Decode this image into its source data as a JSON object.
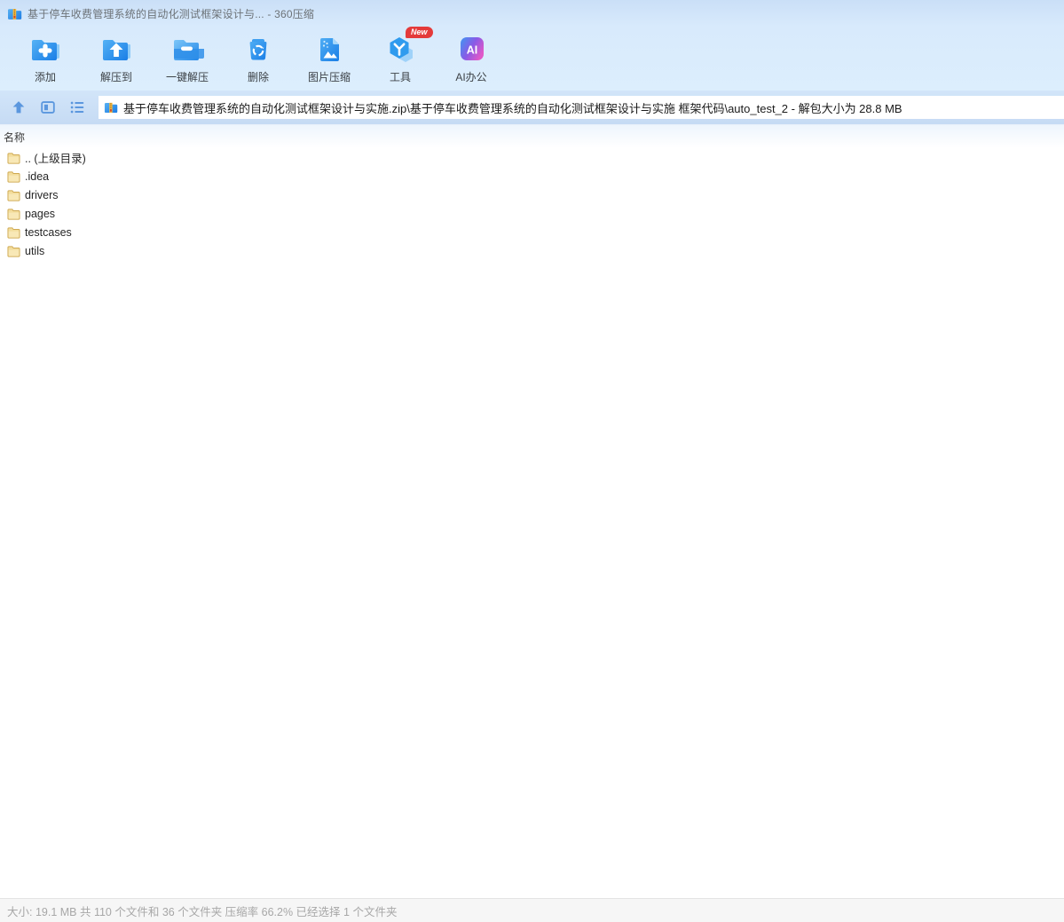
{
  "window": {
    "title": "基于停车收费管理系统的自动化测试框架设计与... - 360压缩"
  },
  "toolbar": {
    "buttons": [
      {
        "label": "添加",
        "icon": "add-archive-icon"
      },
      {
        "label": "解压到",
        "icon": "extract-to-icon"
      },
      {
        "label": "一键解压",
        "icon": "one-click-extract-icon"
      },
      {
        "label": "删除",
        "icon": "delete-icon"
      },
      {
        "label": "图片压缩",
        "icon": "image-compress-icon"
      },
      {
        "label": "工具",
        "icon": "tools-icon",
        "badge": "New"
      },
      {
        "label": "AI办公",
        "icon": "ai-office-icon"
      }
    ]
  },
  "navbar": {
    "nav_icons": [
      "up-icon",
      "detail-view-icon",
      "list-view-icon"
    ],
    "address": "基于停车收费管理系统的自动化测试框架设计与实施.zip\\基于停车收费管理系统的自动化测试框架设计与实施 框架代码\\auto_test_2 - 解包大小为 28.8 MB"
  },
  "file_list": {
    "columns": [
      "名称"
    ],
    "items": [
      {
        "name": ".. (上级目录)",
        "type": "folder"
      },
      {
        "name": ".idea",
        "type": "folder"
      },
      {
        "name": "drivers",
        "type": "folder"
      },
      {
        "name": "pages",
        "type": "folder"
      },
      {
        "name": "testcases",
        "type": "folder"
      },
      {
        "name": "utils",
        "type": "folder"
      }
    ]
  },
  "statusbar": {
    "text": "大小: 19.1 MB 共 110 个文件和 36 个文件夹 压缩率 66.2% 已经选择 1 个文件夹"
  },
  "colors": {
    "chrome_blue": "#d8eafc",
    "accent_blue": "#2b8ce8",
    "nav_icon_blue": "#5b97de",
    "folder_yellow": "#f3dd9d",
    "badge_red": "#e43a3a"
  }
}
